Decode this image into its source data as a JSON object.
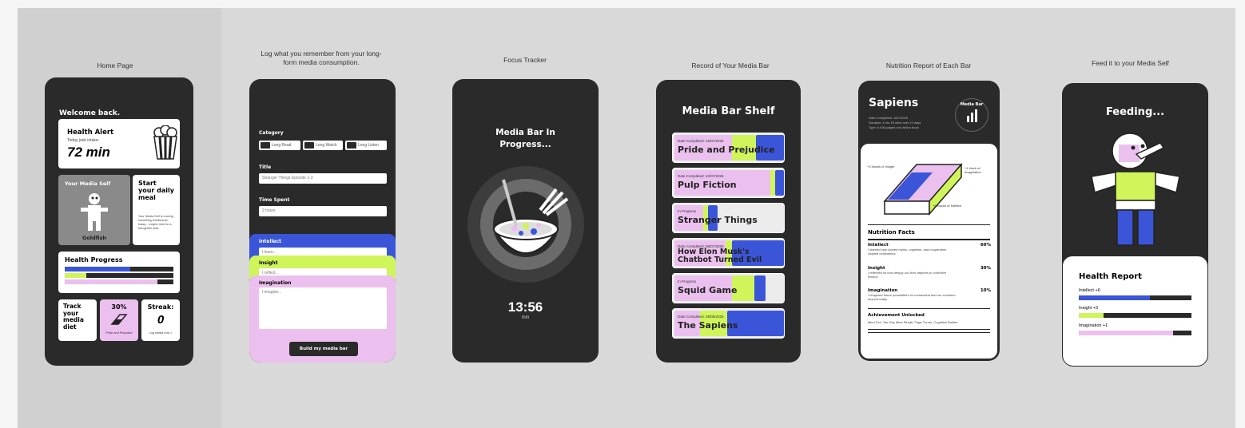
{
  "colors": {
    "blue": "#3b55d9",
    "lime": "#cff55a",
    "pink": "#ebc0ee",
    "dark": "#2a2a2a"
  },
  "captions": {
    "home": "Home Page",
    "log": "Log what you remember from your long-form media consumption.",
    "focus": "Focus Tracker",
    "record": "Record of Your Media Bar",
    "nutrition": "Nutrition Report of Each Bar",
    "feed": "Feed it to your Media Self"
  },
  "home": {
    "welcome": "Welcome back.",
    "alert_title": "Health Alert",
    "alert_sub": "Today junk intake:",
    "alert_value": "72 min",
    "self_title": "Your Media Self",
    "self_name": "Goldfish",
    "start_title": "Start your daily meal",
    "start_desc": "Your Media Self is craving something intellectual today... maybe time for a thoughtful read.",
    "progress_title": "Health Progress",
    "progress": [
      0.6,
      0.2,
      0.85
    ],
    "track": "Track your media diet",
    "pct": "30%",
    "pct_sub": "Pride and Prejudice",
    "streak_title": "Streak:",
    "streak_value": "0",
    "streak_sub": "Log media now >"
  },
  "log": {
    "category_label": "Category",
    "categories": [
      "Long Read",
      "Long Watch",
      "Long Listen"
    ],
    "title_label": "Title",
    "title_value": "Stranger Things Episode 1-3",
    "time_label": "Time Spent",
    "time_value": "2 hours",
    "intellect": "Intellect",
    "intellect_ph": "I learn...",
    "insight": "Insight",
    "insight_ph": "I reflect...",
    "imagination": "Imagination",
    "imagination_ph": "I imagine...",
    "button": "Build my media bar"
  },
  "focus": {
    "title": "Media Bar In Progress...",
    "time": "13:56",
    "unit": "min"
  },
  "shelf": {
    "title": "Media Bar Shelf",
    "items": [
      {
        "date": "Date Completed: 18/07/2025",
        "title": "Pride and Prejudice"
      },
      {
        "date": "Date Completed: 10/07/2025",
        "title": "Pulp Fiction"
      },
      {
        "date": "In Progress",
        "title": "Stranger Things"
      },
      {
        "date": "Date Completed: 05/07/2025",
        "title": "How Elon Musk's Chatbot Turned Evil"
      },
      {
        "date": "In Progress",
        "title": "Squid Game"
      },
      {
        "date": "Date Completed: 29/06/2025",
        "title": "The Sapiens"
      }
    ]
  },
  "report": {
    "title": "Sapiens",
    "date": "Date Completed: 18/7/2025",
    "duration": "Duration: 4 hrs 15 mins over 10 days",
    "type": "Type: a 400-paged non-fiction book",
    "badge": "Media Bar",
    "ann_insight": "+3 blocks of Insight",
    "ann_imagination": "+1 block of Imagination",
    "ann_intellect": "+6 blocks of Intellect",
    "facts_title": "Nutrition Facts",
    "facts": [
      {
        "name": "Intellect",
        "pct": "60%",
        "desc": "I learned how shared myths, cognition, and cooperation shaped civilizations."
      },
      {
        "name": "Insight",
        "pct": "30%",
        "desc": "I reflected on how deeply our lives depend on collective fictions."
      },
      {
        "name": "Imagination",
        "pct": "10%",
        "desc": "I imagined future possibilities for humankind and our evolution beyond today."
      }
    ],
    "ach_title": "Achievement Unlocked",
    "ach_desc": "Mind Fed, Ten-Day Mind Streak, Page Turner, Cognitive Builder"
  },
  "feed": {
    "title": "Feeding...",
    "report_title": "Health Report",
    "stats": [
      {
        "label": "Intellect +6",
        "level": 0.63
      },
      {
        "label": "Insight +3",
        "level": 0.22
      },
      {
        "label": "Imagination +1",
        "level": 0.84
      }
    ]
  }
}
